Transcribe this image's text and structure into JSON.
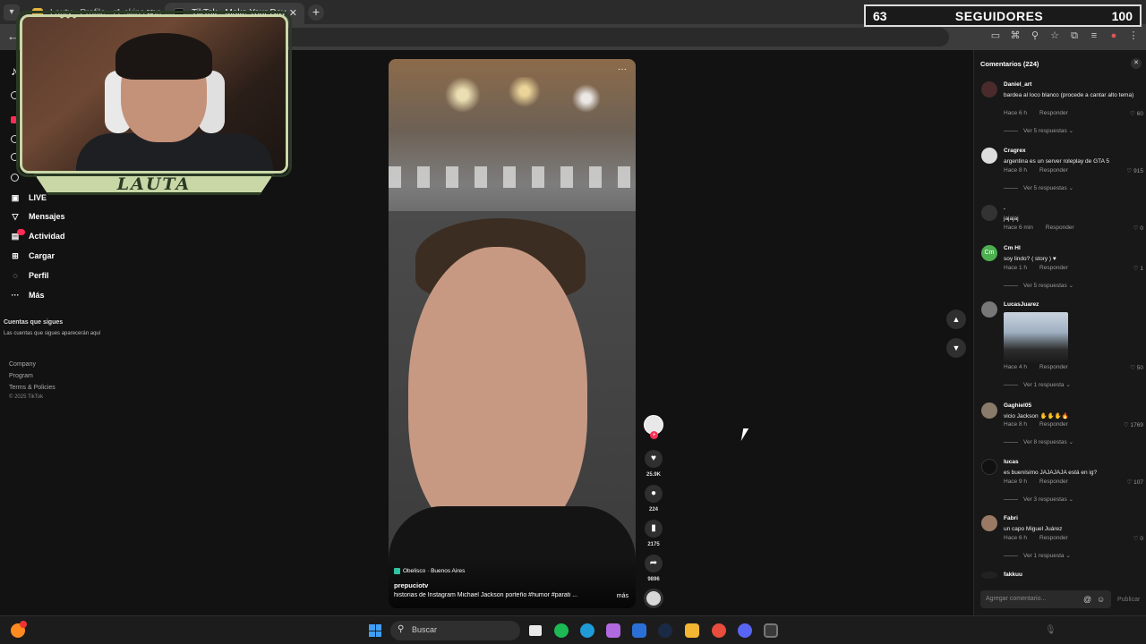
{
  "browser": {
    "tabs": [
      {
        "title": "Lauty - Profile - r1-skins.com"
      },
      {
        "title": "TikTok - Make Your Day"
      }
    ],
    "address_fragment": "2"
  },
  "overlay": {
    "followers_current": "63",
    "followers_label": "SEGUIDORES",
    "followers_goal": "100",
    "streamer_name": "LAUTA"
  },
  "sidebar": {
    "items": [
      {
        "label": "LIVE"
      },
      {
        "label": "Mensajes"
      },
      {
        "label": "Actividad"
      },
      {
        "label": "Cargar"
      },
      {
        "label": "Perfil"
      },
      {
        "label": "Más"
      }
    ],
    "following_title": "Cuentas que sigues",
    "following_note": "Las cuentas que sigues aparecerán aquí",
    "footer": [
      "Company",
      "Program",
      "Terms & Policies"
    ],
    "copyright": "© 2025 TikTok"
  },
  "video": {
    "location": "Obelisco · Buenos Aires",
    "username": "prepuciotv",
    "description": "historias de Instagram  Michael Jackson porteño #humor  #parati  ...",
    "more_label": "más",
    "menu_glyph": "···"
  },
  "actions": {
    "likes": "25.9K",
    "comments": "224",
    "saves": "2175",
    "shares": "9896"
  },
  "comments": {
    "title": "Comentarios (224)",
    "items": [
      {
        "user": "Daniel_art",
        "text": "bardea al loco blanco (procede a cantar alto tema)",
        "time": "Hace 6 h",
        "reply": "Responder",
        "likes": "60",
        "replies": "Ver 5 respuestas"
      },
      {
        "user": "Cragrex",
        "text": "argentina es un server roleplay de GTA 5",
        "time": "Hace 8 h",
        "reply": "Responder",
        "likes": "915",
        "replies": "Ver 5 respuestas"
      },
      {
        "user": ".",
        "text": "jajajaj",
        "time": "Hace 6 min",
        "reply": "Responder",
        "likes": "0",
        "replies": ""
      },
      {
        "user": "Cm Hl",
        "text": "soy lindo? ( story ) ♥",
        "time": "Hace 1 h",
        "reply": "Responder",
        "likes": "1",
        "replies": "Ver 5 respuestas"
      },
      {
        "user": "LucasJuarez",
        "text": "",
        "time": "Hace 4 h",
        "reply": "Responder",
        "likes": "50",
        "replies": "Ver 1 respuesta"
      },
      {
        "user": "Gaghiel05",
        "text": "vicio Jackson ✋✋✋🔥",
        "time": "Hace 8 h",
        "reply": "Responder",
        "likes": "1769",
        "replies": "Ver 8 respuestas"
      },
      {
        "user": "lucas",
        "text": "es buenísimo JAJAJAJA está en ig?",
        "time": "Hace 9 h",
        "reply": "Responder",
        "likes": "107",
        "replies": "Ver 3 respuestas"
      },
      {
        "user": "Fabri",
        "text": "un capo Miguel Juárez",
        "time": "Hace 6 h",
        "reply": "Responder",
        "likes": "0",
        "replies": "Ver 1 respuesta"
      },
      {
        "user": "fakkuu",
        "text": "",
        "time": "",
        "reply": "",
        "likes": "",
        "replies": ""
      }
    ],
    "input_placeholder": "Agregar comentario...",
    "post_label": "Publicar"
  },
  "taskbar": {
    "search_placeholder": "Buscar"
  },
  "colors": {
    "tiktok_red": "#fe2c55",
    "overlay_green": "#c9d7a7",
    "windows_blue": "#3f9ff5"
  }
}
